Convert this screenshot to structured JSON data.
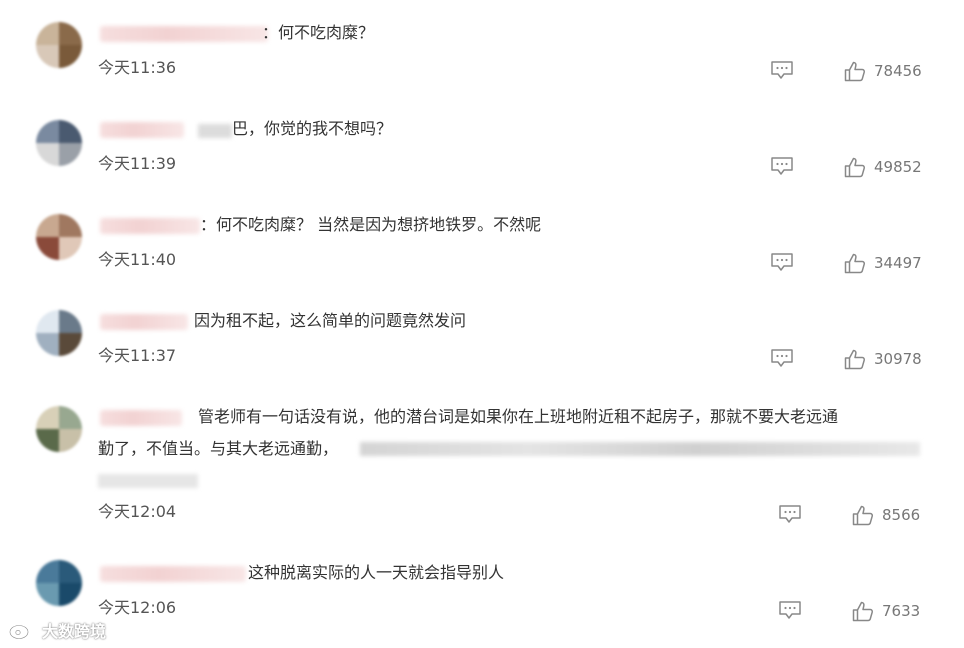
{
  "comments": [
    {
      "text": "：何不吃肉糜？",
      "time": "今天11:36",
      "likes": "78456",
      "avatar_colors": [
        "#c9b49a",
        "#8a6a4a",
        "#d8c8b8",
        "#7a5a3a"
      ]
    },
    {
      "text": "巴，你觉的我不想吗？",
      "time": "今天11:39",
      "likes": "49852",
      "avatar_colors": [
        "#7a8aa0",
        "#4a5a70",
        "#d8d8d8",
        "#9aa0a8"
      ]
    },
    {
      "text": "：何不吃肉糜？ 当然是因为想挤地铁罗。不然呢",
      "time": "今天11:40",
      "likes": "34497",
      "avatar_colors": [
        "#c8a890",
        "#a07860",
        "#8a4a3a",
        "#e0c8b8"
      ]
    },
    {
      "text": "因为租不起，这么简单的问题竟然发问",
      "time": "今天11:37",
      "likes": "30978",
      "avatar_colors": [
        "#e0e8f0",
        "#6a7a8a",
        "#a0b0c0",
        "#5a4a3a"
      ]
    },
    {
      "text_line1": "管老师有一句话没有说，他的潜台词是如果你在上班地附近租不起房子，那就不要大老远通",
      "text_line2": "勤了，不值当。与其大老远通勤，",
      "time": "今天12:04",
      "likes": "8566",
      "avatar_colors": [
        "#d8d0b8",
        "#98a890",
        "#5a6a4a",
        "#c8c0a8"
      ]
    },
    {
      "text": "这种脱离实际的人一天就会指导别人",
      "time": "今天12:06",
      "likes": "7633",
      "avatar_colors": [
        "#4a7a9a",
        "#2a5a7a",
        "#6a9ab0",
        "#1a4a6a"
      ]
    }
  ],
  "icons": {
    "reply": "comment-bubble-icon",
    "like": "thumbs-up-icon",
    "watermark": "weibo-logo-icon"
  },
  "watermark": {
    "text": "大数跨境"
  },
  "colors": {
    "text": "#333333",
    "time": "#555555",
    "count": "#777777",
    "icon": "#888888"
  }
}
